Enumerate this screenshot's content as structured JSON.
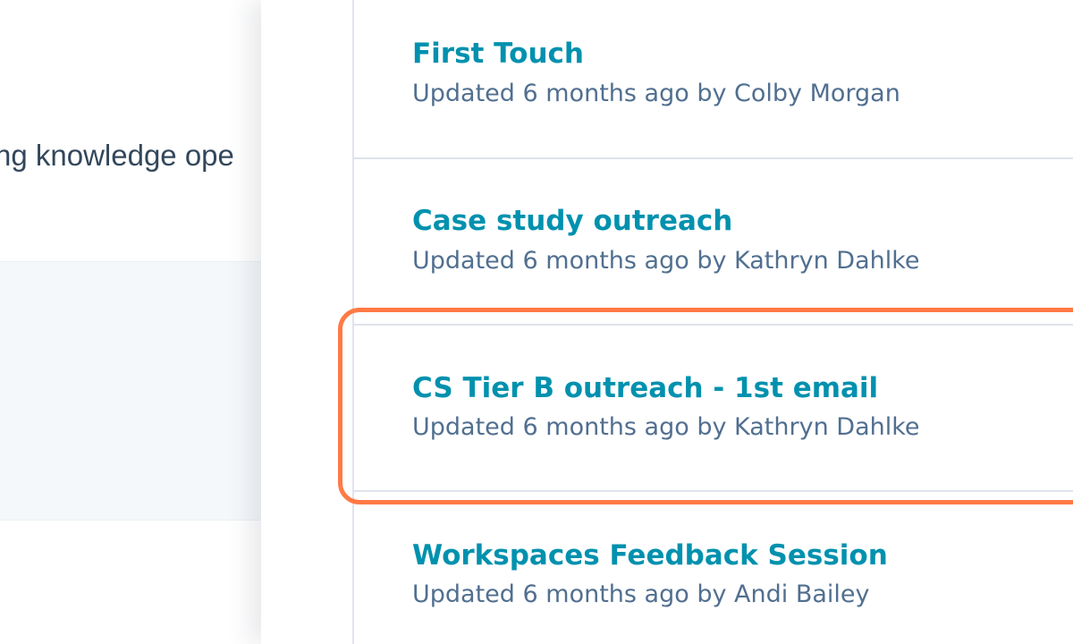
{
  "background": {
    "partial_text": "ng knowledge ope"
  },
  "templates": {
    "items": [
      {
        "title": "First Touch",
        "meta": "Updated 6 months ago by Colby Morgan"
      },
      {
        "title": "Case study outreach",
        "meta": "Updated 6 months ago by Kathryn Dahlke"
      },
      {
        "title": "CS Tier B outreach - 1st email",
        "meta": "Updated 6 months ago by Kathryn Dahlke"
      },
      {
        "title": "Workspaces Feedback Session",
        "meta": "Updated 6 months ago by Andi Bailey"
      }
    ],
    "highlighted_index": 2
  },
  "colors": {
    "title_link": "#0091ae",
    "meta_text": "#516f90",
    "highlight": "#ff7a45",
    "divider": "#dfe3eb"
  }
}
